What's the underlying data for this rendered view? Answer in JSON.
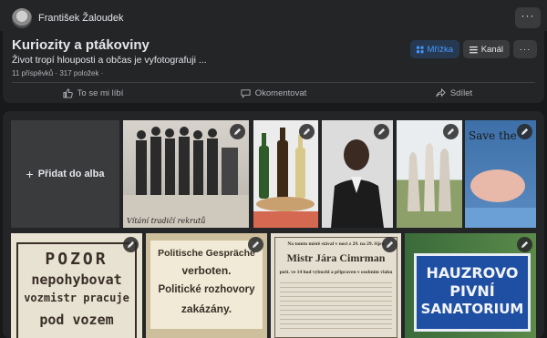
{
  "author": {
    "name": "František Žaloudek"
  },
  "album": {
    "title": "Kuriozity a ptákoviny",
    "description": "Život tropí hlouposti a občas je vyfotografuji ...",
    "meta": "11 příspěvků · 317 položek ·",
    "grid_label": "Mřížka",
    "channel_label": "Kanál",
    "more_label": "···"
  },
  "actions": {
    "like": "To se mi líbí",
    "comment": "Okomentovat",
    "share": "Sdílet"
  },
  "add_photo": {
    "label": "Přidat do alba",
    "icon": "plus-icon"
  },
  "photos": {
    "soldiers_caption": "Vítání tradičí rekrutů",
    "sign_warning": [
      "POZOR",
      "nepohybovat",
      "vozmistr pracuje",
      "pod vozem"
    ],
    "sign_politics": [
      "Politische Gespräche",
      "verboten.",
      "Politické rozhovory",
      "zakázány."
    ],
    "sign_plaque": [
      "Na tomto místě stával v noci z 29. na 29. říjen",
      "Mistr Jára Cimrman",
      "pošt. ve 14 hod vybuchl a připraven v osobním vlaku"
    ],
    "sign_hauzr": [
      "HAUZROVO",
      "PIVNÍ",
      "SANATORIUM"
    ],
    "sign_save": "Save the"
  },
  "colors": {
    "accent": "#4599ff",
    "surface": "#242526",
    "background": "#18191a"
  }
}
